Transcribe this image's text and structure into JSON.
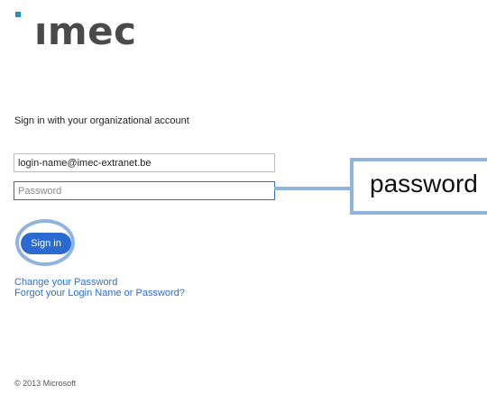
{
  "brand": {
    "logo_text": "ımec",
    "accent": "#2a8bc6"
  },
  "form": {
    "heading": "Sign in with your organizational account",
    "username_value": "login-name@imec-extranet.be",
    "password_placeholder": "Password",
    "signin_label": "Sign in"
  },
  "annotation": {
    "callout_text": "password"
  },
  "links": {
    "change_password": "Change your Password",
    "forgot": "Forgot your Login Name or Password?"
  },
  "footer": {
    "copyright": "© 2013 Microsoft"
  },
  "colors": {
    "primary": "#2b6ad0",
    "link": "#2a6fd6",
    "annotation": "#8fb5dc"
  }
}
